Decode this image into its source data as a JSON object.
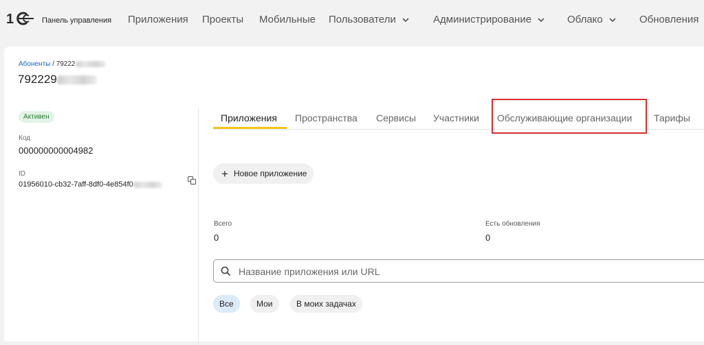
{
  "header": {
    "logo_text": "1С",
    "app_title": "Панель управления",
    "nav": [
      {
        "label": "Приложения",
        "dropdown": false
      },
      {
        "label": "Проекты",
        "dropdown": false
      },
      {
        "label": "Мобильные",
        "dropdown": false
      },
      {
        "label": "Пользователи",
        "dropdown": true
      },
      {
        "label": "Администрирование",
        "dropdown": true
      },
      {
        "label": "Облако",
        "dropdown": true
      },
      {
        "label": "Обновления",
        "dropdown": false
      }
    ]
  },
  "breadcrumb": {
    "parent": "Абоненты",
    "separator": "/",
    "current_visible": "79222"
  },
  "page": {
    "title_visible": "792229"
  },
  "subscriber": {
    "status": "Активен",
    "code_label": "Код",
    "code_value": "000000000004982",
    "id_label": "ID",
    "id_value_visible": "01956010-cb32-7aff-8df0-4e854f0"
  },
  "tabs": [
    {
      "label": "Приложения",
      "active": true
    },
    {
      "label": "Пространства",
      "active": false
    },
    {
      "label": "Сервисы",
      "active": false
    },
    {
      "label": "Участники",
      "active": false
    },
    {
      "label": "Обслуживающие организации",
      "active": false,
      "highlighted": true
    },
    {
      "label": "Тарифы",
      "active": false
    }
  ],
  "actions": {
    "new_app_label": "Новое приложение"
  },
  "stats": {
    "total_label": "Всего",
    "total_value": "0",
    "updates_label": "Есть обновления",
    "updates_value": "0"
  },
  "search": {
    "placeholder": "Название приложения или URL",
    "value": ""
  },
  "filters": [
    {
      "label": "Все",
      "selected": true
    },
    {
      "label": "Мои",
      "selected": false
    },
    {
      "label": "В моих задачах",
      "selected": false
    }
  ],
  "colors": {
    "accent_tab": "#f5c518",
    "highlight_border": "#d32f2f",
    "status_green": "#2e7d32",
    "link": "#1565c0"
  }
}
